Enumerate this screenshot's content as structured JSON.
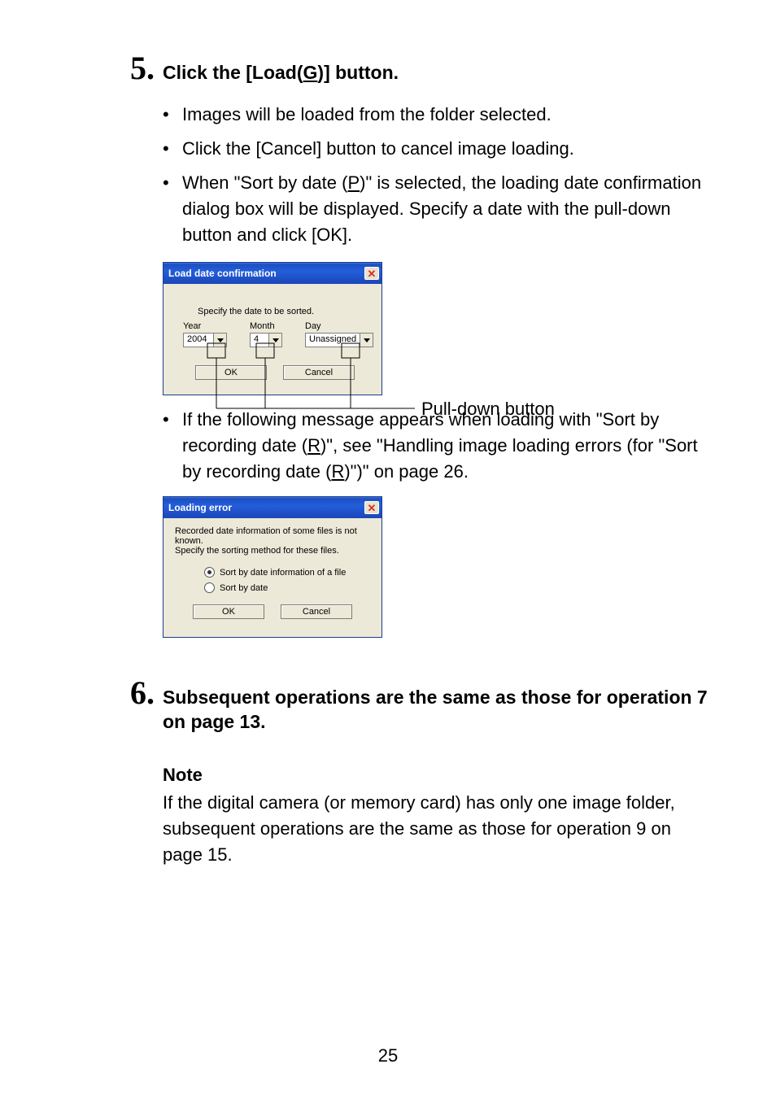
{
  "step5": {
    "number": "5.",
    "heading_pre": "Click the [Load(",
    "heading_key": "G",
    "heading_post": ")] button.",
    "bullets": {
      "b1": "Images will be loaded from the folder selected.",
      "b2": "Click the [Cancel] button to cancel image loading.",
      "b3_pre": "When \"Sort by date (",
      "b3_key": "P",
      "b3_post": ")\" is selected, the loading date confirmation dialog box will be displayed. Specify a date with the pull-down button and click [OK].",
      "b4_pre": "If the following message appears when loading with \"Sort by recording date (",
      "b4_key1": "R",
      "b4_mid": ")\", see \"Handling image loading errors (for \"Sort by recording date (",
      "b4_key2": "R",
      "b4_post": ")\")\" on page 26."
    }
  },
  "callout": {
    "pulldown": "Pull-down button"
  },
  "dialog1": {
    "title": "Load date confirmation",
    "instruction": "Specify the date to be sorted.",
    "labels": {
      "year": "Year",
      "month": "Month",
      "day": "Day"
    },
    "values": {
      "year": "2004",
      "month": "4",
      "day": "Unassigned"
    },
    "buttons": {
      "ok": "OK",
      "cancel": "Cancel"
    }
  },
  "dialog2": {
    "title": "Loading error",
    "msg_line1": "Recorded date information of some files is not known.",
    "msg_line2": "Specify the sorting method for these files.",
    "radios": {
      "opt1": "Sort by date information of a file",
      "opt2": "Sort by date"
    },
    "buttons": {
      "ok": "OK",
      "cancel": "Cancel"
    }
  },
  "step6": {
    "number": "6.",
    "heading": "Subsequent operations are the same as those for operation 7 on page 13."
  },
  "note": {
    "title": "Note",
    "body": "If the digital camera (or memory card) has only one image folder, subsequent operations are the same as those for operation 9 on page 15."
  },
  "page_number": "25"
}
